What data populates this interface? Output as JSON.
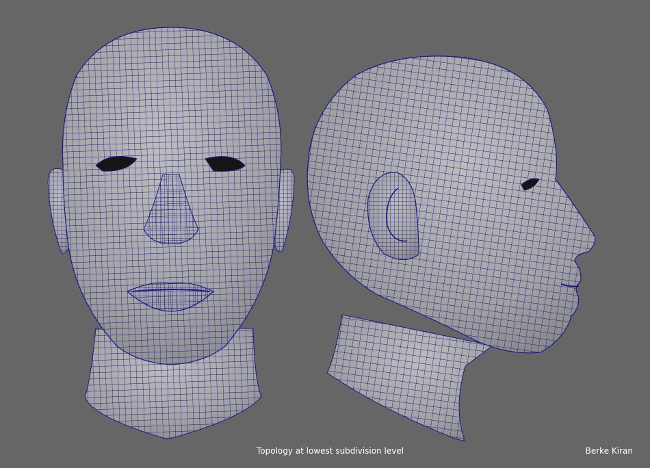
{
  "render": {
    "background_color": "#666666",
    "mesh_fill_color": "#a8a8a8",
    "wire_color": "#1a1a8c",
    "views": [
      "front-view",
      "profile-view"
    ]
  },
  "captions": {
    "center_text": "Topology at lowest subdivision level",
    "author": "Berke Kiran"
  }
}
